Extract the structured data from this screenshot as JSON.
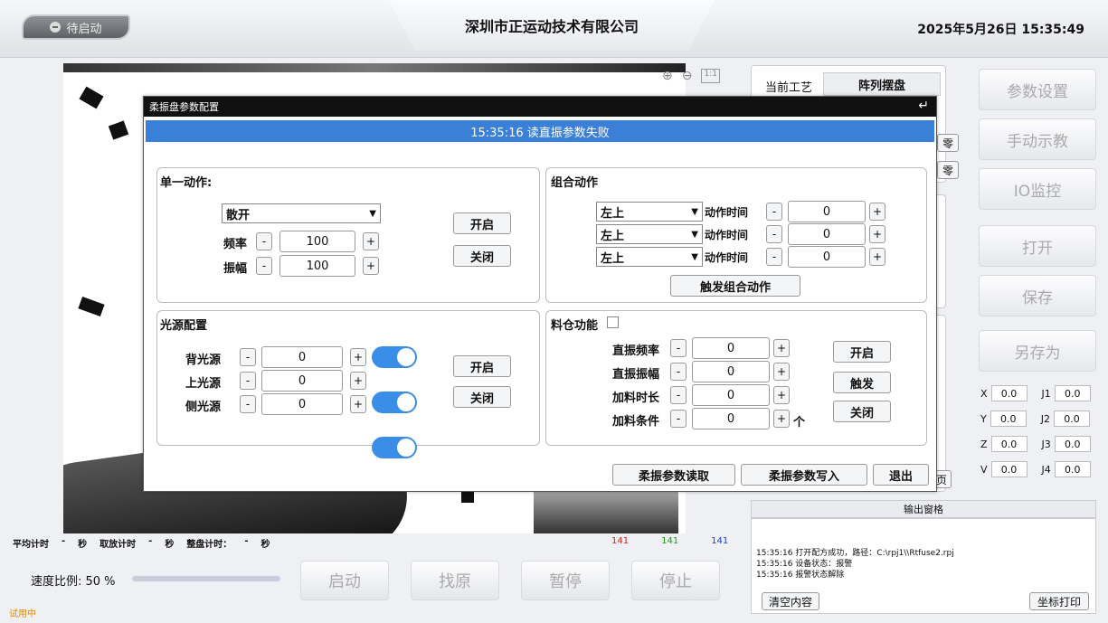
{
  "header": {
    "status": "待启动",
    "company": "深圳市正运动技术有限公司",
    "datetime": "2025年5月26日  15:35:49"
  },
  "camera": {
    "zoom_in_icon": "zoom-in-icon",
    "zoom_out_icon": "zoom-out-icon",
    "fit_label": "1:1"
  },
  "timers": {
    "avg_label": "平均计时",
    "avg_val": "-",
    "avg_unit": "秒",
    "place_label": "取放计时",
    "place_val": "-",
    "place_unit": "秒",
    "tray_label": "整盘计时：",
    "tray_val": "-",
    "tray_unit": "秒"
  },
  "counts": [
    {
      "val": "141",
      "color": "#d02020"
    },
    {
      "val": "141",
      "color": "#18a018"
    },
    {
      "val": "141",
      "color": "#2040c0"
    }
  ],
  "speed": {
    "label": "速度比例: 50 %",
    "value": 0.5
  },
  "trial": "试用中",
  "controls": {
    "start": "启动",
    "home": "找原",
    "pause": "暂停",
    "stop": "停止"
  },
  "craft": {
    "label": "当前工艺",
    "value": "阵列摆盘",
    "hidden1": "零",
    "hidden2": "零",
    "hidden3": "页"
  },
  "right": {
    "params": "参数设置",
    "teach": "手动示教",
    "io": "IO监控",
    "open": "打开",
    "save": "保存",
    "save_as": "另存为"
  },
  "coords": [
    {
      "a": "X",
      "av": "0.0",
      "b": "J1",
      "bv": "0.0"
    },
    {
      "a": "Y",
      "av": "0.0",
      "b": "J2",
      "bv": "0.0"
    },
    {
      "a": "Z",
      "av": "0.0",
      "b": "J3",
      "bv": "0.0"
    },
    {
      "a": "V",
      "av": "0.0",
      "b": "J4",
      "bv": "0.0"
    }
  ],
  "output": {
    "title": "输出窗格",
    "lines": [
      "15:35:16  打开配方成功，路径：C:\\rpj1\\\\Rtfuse2.rpj",
      "15:35:16  设备状态：报警",
      "15:35:16  报警状态解除"
    ],
    "clear": "清空内容",
    "print": "坐标打印"
  },
  "dialog": {
    "title": "柔振盘参数配置",
    "message": "15:35:16 读直振参数失败",
    "single": {
      "title": "单一动作:",
      "action": "散开",
      "freq_label": "频率",
      "freq": "100",
      "amp_label": "振幅",
      "amp": "100",
      "open": "开启",
      "close": "关闭"
    },
    "combo": {
      "title": "组合动作",
      "rows": [
        {
          "dir": "左上",
          "label": "动作时间",
          "val": "0"
        },
        {
          "dir": "左上",
          "label": "动作时间",
          "val": "0"
        },
        {
          "dir": "左上",
          "label": "动作时间",
          "val": "0"
        }
      ],
      "trigger": "触发组合动作"
    },
    "light": {
      "title": "光源配置",
      "rows": [
        {
          "label": "背光源",
          "val": "0"
        },
        {
          "label": "上光源",
          "val": "0"
        },
        {
          "label": "侧光源",
          "val": "0"
        }
      ],
      "open": "开启",
      "close": "关闭"
    },
    "hopper": {
      "title": "料仓功能",
      "rows": [
        {
          "label": "直振频率",
          "val": "0"
        },
        {
          "label": "直振振幅",
          "val": "0"
        },
        {
          "label": "加料时长",
          "val": "0"
        },
        {
          "label": "加料条件",
          "val": "0",
          "unit": "个"
        }
      ],
      "open": "开启",
      "trigger": "触发",
      "close": "关闭"
    },
    "read": "柔振参数读取",
    "write": "柔振参数写入",
    "exit": "退出"
  }
}
